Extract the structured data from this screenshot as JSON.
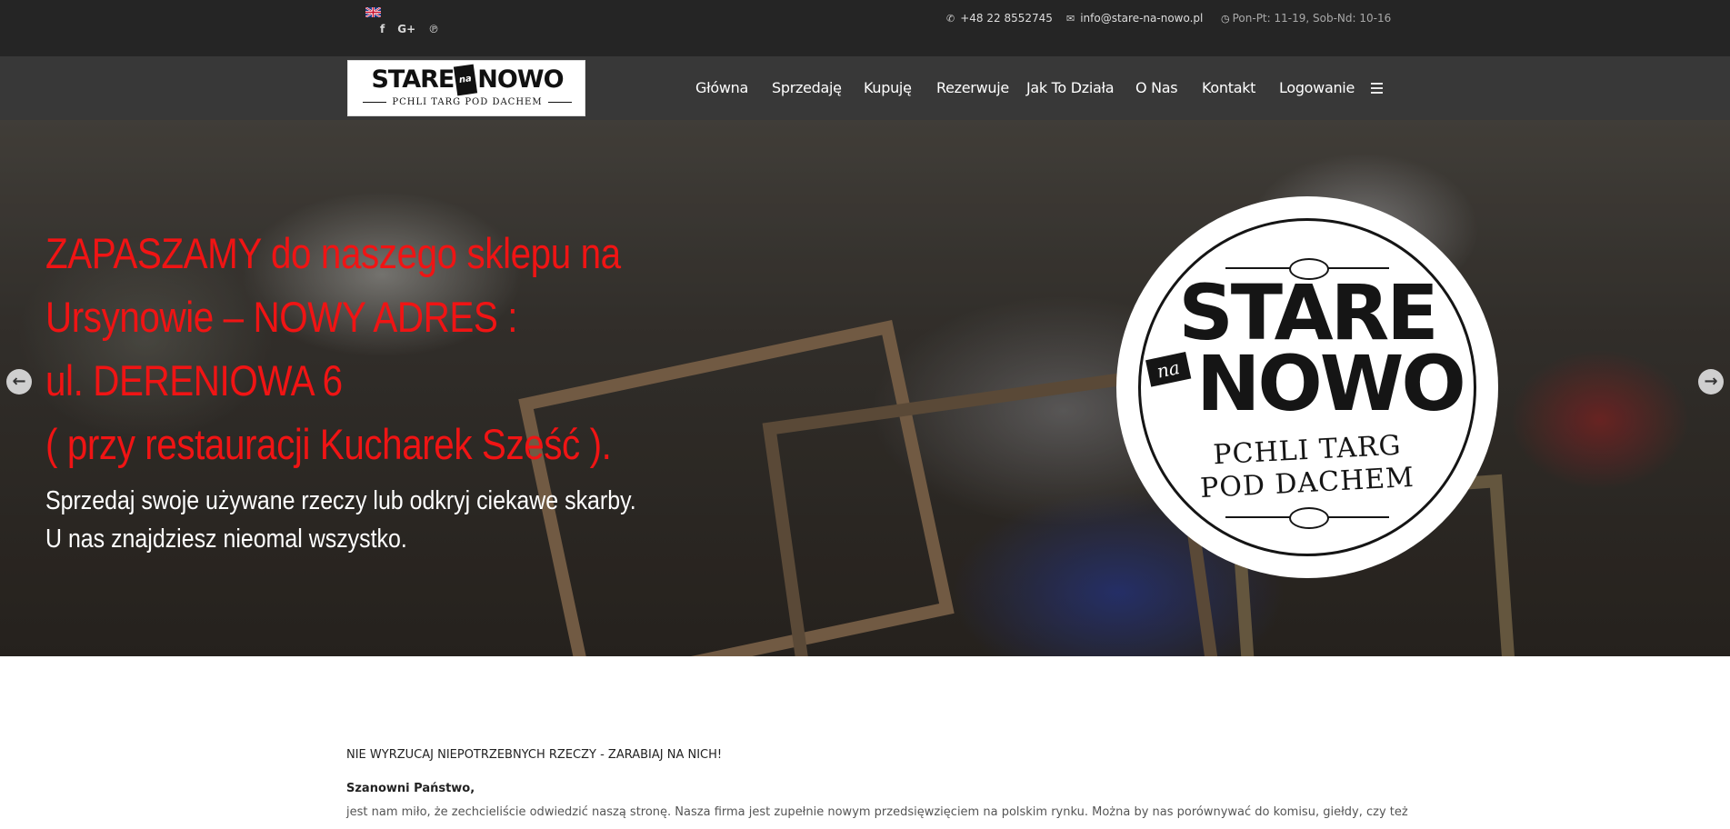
{
  "topbar": {
    "language_icon": "uk-flag-icon",
    "socials": [
      {
        "name": "facebook-icon",
        "glyph": "f"
      },
      {
        "name": "google-plus-icon",
        "glyph": "G+"
      },
      {
        "name": "pinterest-icon",
        "glyph": "℗"
      }
    ],
    "phone_icon": "phone-icon",
    "phone": "+48 22 8552745",
    "email_icon": "envelope-icon",
    "email": "info@stare-na-nowo.pl",
    "hours_icon": "clock-icon",
    "hours": "Pon-Pt: 11-19, Sob-Nd: 10-16"
  },
  "logo": {
    "word1": "STARE",
    "word_na": "na",
    "word2": "NOWO",
    "tagline": "PCHLI TARG POD DACHEM"
  },
  "nav": {
    "items": [
      "Główna",
      "Sprzedaję",
      "Kupuję",
      "Rezerwuje",
      "Jak To Działa",
      "O Nas",
      "Kontakt",
      "Logowanie"
    ],
    "menu_icon": "hamburger-icon"
  },
  "hero": {
    "headline_lines": [
      "ZAPASZAMY do naszego sklepu na",
      "Ursynowie – NOWY ADRES :",
      "ul. DERENIOWA 6",
      "( przy restauracji Kucharek Sześć )."
    ],
    "sub_lines": [
      "Sprzedaj swoje używane rzeczy lub odkryj ciekawe skarby.",
      "U nas znajdziesz nieomal wszystko."
    ],
    "badge": {
      "word1": "STARE",
      "word_na": "na",
      "word2": "NOWO",
      "sub1": "PCHLI TARG",
      "sub2": "POD DACHEM"
    },
    "prev_icon": "arrow-left-icon",
    "next_icon": "arrow-right-icon",
    "prev_glyph": "←",
    "next_glyph": "→"
  },
  "content": {
    "intro": "NIE WYRZUCAJ NIEPOTRZEBNYCH RZECZY - ZARABIAJ NA NICH!",
    "greeting": "Szanowni Państwo,",
    "paragraph": "jest nam miło, że zechcieliście odwiedzić naszą stronę. Nasza firma jest zupełnie nowym przedsięwzięciem na polskim rynku. Można by nas porównywać do komisu, giełdy, czy też"
  },
  "colors": {
    "topbar_bg": "#252525",
    "navbar_bg": "#383838",
    "headline_red": "#f01414"
  }
}
